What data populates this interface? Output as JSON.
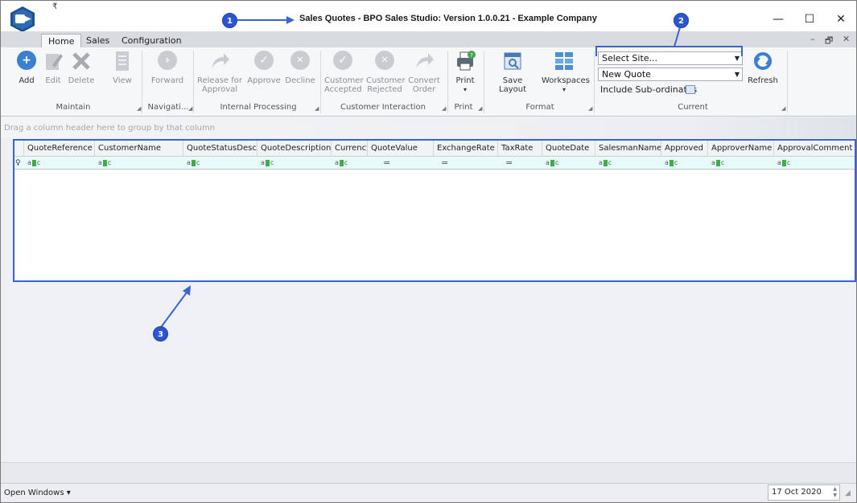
{
  "window": {
    "title": "Sales Quotes - BPO Sales Studio: Version 1.0.0.21 - Example Company",
    "qat_glyph": "₹",
    "minimize": "—",
    "maximize": "☐",
    "close": "✕",
    "mdi_minimize": "–",
    "mdi_restore": "🗗",
    "mdi_close": "✕"
  },
  "tabs": [
    "Home",
    "Sales",
    "Configuration"
  ],
  "ribbon": {
    "maintain": {
      "label": "Maintain",
      "buttons": [
        "Add",
        "Edit",
        "Delete",
        "View"
      ]
    },
    "navigation": {
      "label": "Navigati...",
      "buttons": [
        "Forward"
      ]
    },
    "internal_processing": {
      "label": "Internal Processing",
      "buttons": [
        "Release for Approval",
        "Approve",
        "Decline"
      ]
    },
    "customer_interaction": {
      "label": "Customer Interaction",
      "buttons": [
        "Customer Accepted",
        "Customer Rejected",
        "Convert Order"
      ]
    },
    "print": {
      "label": "Print",
      "buttons": [
        "Print"
      ]
    },
    "format": {
      "label": "Format",
      "buttons": [
        "Save Layout",
        "Workspaces"
      ]
    },
    "current": {
      "label": "Current",
      "site_select": "Select Site...",
      "quote_select": "New Quote",
      "include_subordinates": "Include Sub-ordinates",
      "refresh": "Refresh"
    }
  },
  "group_hint": "Drag a column header here to group by that column",
  "grid": {
    "columns": [
      "QuoteReference",
      "CustomerName",
      "QuoteStatusDesc",
      "QuoteDescription",
      "Currency",
      "QuoteValue",
      "ExchangeRate",
      "TaxRate",
      "QuoteDate",
      "SalesmanName",
      "Approved",
      "ApproverName",
      "ApprovalComment"
    ],
    "filter_types": [
      "abc",
      "abc",
      "abc",
      "abc",
      "abc",
      "eq",
      "eq",
      "eq",
      "abc",
      "abc",
      "abc",
      "abc",
      "abc"
    ],
    "eq_glyph": "="
  },
  "status": {
    "open_windows": "Open Windows ▾",
    "date": "17 Oct 2020"
  },
  "callouts": [
    "1",
    "2",
    "3"
  ],
  "colors": {
    "callout": "#2a56d6",
    "add_icon": "#3b7fd4",
    "disabled_icon": "#c9ccd1"
  }
}
